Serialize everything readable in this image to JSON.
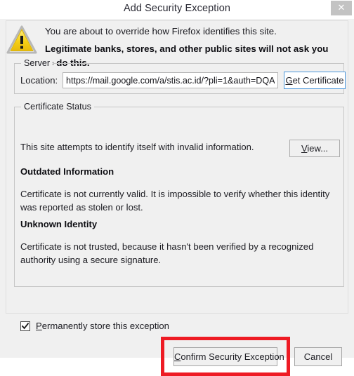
{
  "window": {
    "title": "Add Security Exception",
    "close_label": "✕",
    "close_icon": "close-icon"
  },
  "warning": {
    "icon": "warning-triangle-icon",
    "line1": "You are about to override how Firefox identifies this site.",
    "line2": "Legitimate banks, stores, and other public sites will not ask you to do this."
  },
  "server_group": {
    "legend": "Server",
    "location_label": "Location:",
    "location_value": "https://mail.google.com/a/stis.ac.id/?pli=1&auth=DQA",
    "location_placeholder": "https://",
    "get_certificate_button": {
      "accel": "G",
      "rest": "et Certificate"
    }
  },
  "certificate_status_group": {
    "legend": "Certificate Status",
    "summary": "This site attempts to identify itself with invalid information.",
    "view_button": {
      "accel": "V",
      "rest": "iew..."
    },
    "sections": [
      {
        "heading": "Outdated Information",
        "body": "Certificate is not currently valid. It is impossible to verify whether this identity was reported as stolen or lost."
      },
      {
        "heading": "Unknown Identity",
        "body": "Certificate is not trusted, because it hasn't been verified by a recognized authority using a secure signature."
      }
    ]
  },
  "permanent_checkbox": {
    "checked": true,
    "accel": "P",
    "rest": "ermanently store this exception"
  },
  "footer": {
    "confirm_button": {
      "accel": "C",
      "rest": "onfirm Security Exception"
    },
    "cancel_button": "Cancel"
  },
  "annotation": {
    "highlight_color": "#ee1b24",
    "target": "confirm-security-exception-button"
  },
  "colors": {
    "dialog_background": "#f0f0f0",
    "titlebar_background": "#ffffff",
    "close_button_background": "#c3c3c3",
    "focus_border": "#4b96da",
    "warning_yellow": "#f5d020",
    "text": "#1c1c22"
  }
}
